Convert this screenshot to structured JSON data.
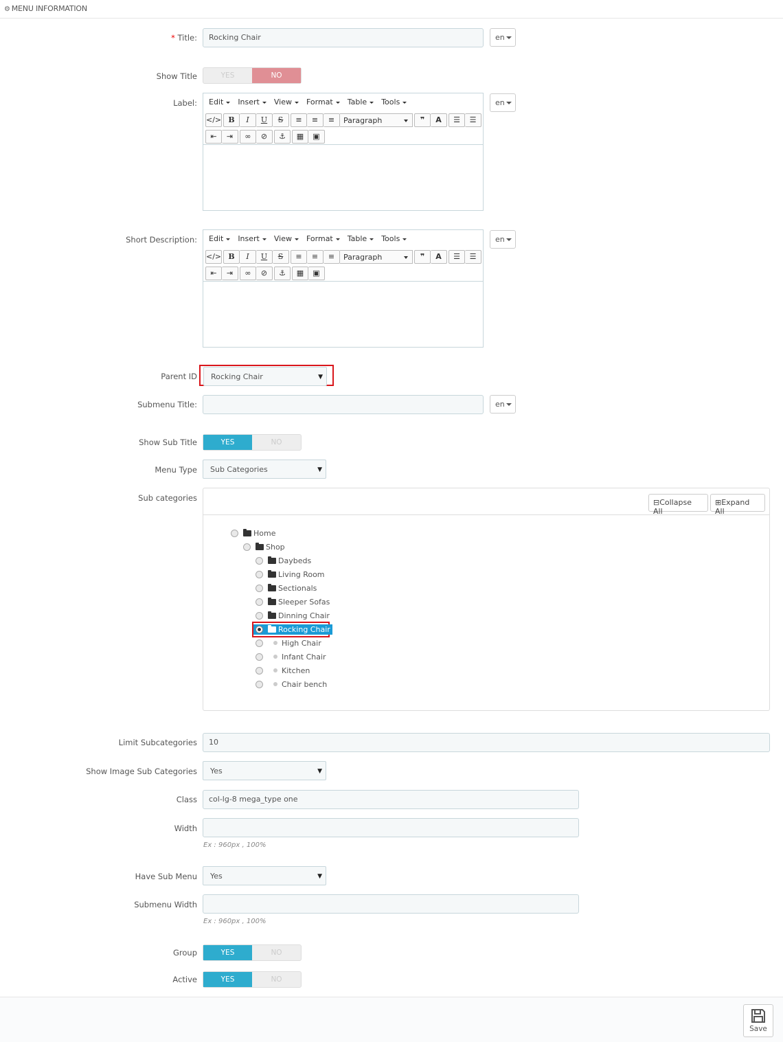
{
  "header": {
    "title": "MENU INFORMATION",
    "icon": "gears-icon"
  },
  "form": {
    "title": {
      "label": "Title:",
      "required": "*",
      "value": "Rocking Chair",
      "lang": "en"
    },
    "show_title": {
      "label": "Show Title",
      "yes": "YES",
      "no": "NO",
      "selected": "NO"
    },
    "label": {
      "label": "Label:",
      "lang": "en"
    },
    "short_description": {
      "label": "Short Description:",
      "lang": "en"
    },
    "editor": {
      "menus": [
        "Edit",
        "Insert",
        "View",
        "Format",
        "Table",
        "Tools"
      ],
      "format_select": "Paragraph"
    },
    "parent_id": {
      "label": "Parent ID",
      "value": "Rocking Chair"
    },
    "submenu_title": {
      "label": "Submenu Title:",
      "value": "",
      "lang": "en"
    },
    "show_sub_title": {
      "label": "Show Sub Title",
      "yes": "YES",
      "no": "NO",
      "selected": "YES"
    },
    "menu_type": {
      "label": "Menu Type",
      "value": "Sub Categories"
    },
    "sub_categories": {
      "label": "Sub categories",
      "collapse_all": "Collapse All",
      "expand_all": "Expand All",
      "tree": [
        {
          "name": "Home",
          "type": "folder-open",
          "checked": false
        },
        {
          "name": "Shop",
          "type": "folder-open",
          "checked": false
        },
        {
          "name": "Daybeds",
          "type": "folder",
          "checked": false
        },
        {
          "name": "Living Room",
          "type": "folder",
          "checked": false
        },
        {
          "name": "Sectionals",
          "type": "folder",
          "checked": false
        },
        {
          "name": "Sleeper Sofas",
          "type": "folder",
          "checked": false
        },
        {
          "name": "Dinning Chair",
          "type": "folder",
          "checked": false
        },
        {
          "name": "Rocking Chair",
          "type": "folder",
          "checked": true
        },
        {
          "name": "High Chair",
          "type": "leaf",
          "checked": false
        },
        {
          "name": "Infant Chair",
          "type": "leaf",
          "checked": false
        },
        {
          "name": "Kitchen",
          "type": "leaf",
          "checked": false
        },
        {
          "name": "Chair bench",
          "type": "leaf",
          "checked": false
        }
      ]
    },
    "limit_subcategories": {
      "label": "Limit Subcategories",
      "value": "10"
    },
    "show_image_sub_categories": {
      "label": "Show Image Sub Categories",
      "value": "Yes"
    },
    "class": {
      "label": "Class",
      "value": "col-lg-8 mega_type one"
    },
    "width": {
      "label": "Width",
      "value": "",
      "hint": "Ex : 960px , 100%"
    },
    "have_sub_menu": {
      "label": "Have Sub Menu",
      "value": "Yes"
    },
    "submenu_width": {
      "label": "Submenu Width",
      "value": "",
      "hint": "Ex : 960px , 100%"
    },
    "group": {
      "label": "Group",
      "yes": "YES",
      "no": "NO",
      "selected": "YES"
    },
    "active": {
      "label": "Active",
      "yes": "YES",
      "no": "NO",
      "selected": "YES"
    }
  },
  "footer": {
    "save": "Save"
  },
  "colors": {
    "accent": "#2eacce",
    "no_active": "#e08f95",
    "highlight": "#d9161b",
    "tree_selected": "#1a9bd6"
  }
}
